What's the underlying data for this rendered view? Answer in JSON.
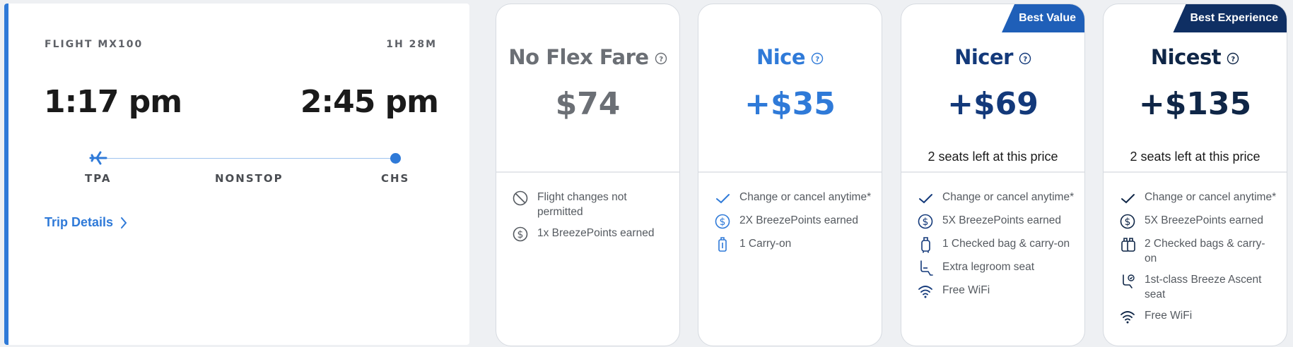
{
  "flight": {
    "number_label": "FLIGHT MX100",
    "duration": "1H 28M",
    "depart_time": "1:17 pm",
    "arrive_time": "2:45 pm",
    "origin": "TPA",
    "stops": "NONSTOP",
    "destination": "CHS",
    "trip_details_label": "Trip Details",
    "accent_color": "#2f7ad8"
  },
  "fares": [
    {
      "name": "No Flex Fare",
      "price": "$74",
      "seats_left": "",
      "badge": "",
      "color": "#6b6f75",
      "features": [
        {
          "icon": "no-changes-icon",
          "text": "Flight changes not permitted"
        },
        {
          "icon": "dollar-icon",
          "text": "1x BreezePoints earned"
        }
      ]
    },
    {
      "name": "Nice",
      "price": "+$35",
      "seats_left": "",
      "badge": "",
      "color": "#2f7ad8",
      "features": [
        {
          "icon": "check-icon",
          "text": "Change or cancel anytime*"
        },
        {
          "icon": "dollar-icon",
          "text": "2X BreezePoints earned"
        },
        {
          "icon": "carry-on-icon",
          "text": "1 Carry-on"
        }
      ]
    },
    {
      "name": "Nicer",
      "price": "+$69",
      "seats_left": "2 seats left at this price",
      "badge": "Best Value",
      "badge_color": "#1f5fb8",
      "color": "#13397a",
      "features": [
        {
          "icon": "check-icon",
          "text": "Change or cancel anytime*"
        },
        {
          "icon": "dollar-icon",
          "text": "5X BreezePoints earned"
        },
        {
          "icon": "checked-bag-icon",
          "text": "1 Checked bag & carry-on"
        },
        {
          "icon": "legroom-seat-icon",
          "text": "Extra legroom seat"
        },
        {
          "icon": "wifi-icon",
          "text": "Free WiFi"
        }
      ]
    },
    {
      "name": "Nicest",
      "price": "+$135",
      "seats_left": "2 seats left at this price",
      "badge": "Best Experience",
      "badge_color": "#0f2f63",
      "color": "#0f2647",
      "features": [
        {
          "icon": "check-icon",
          "text": "Change or cancel anytime*"
        },
        {
          "icon": "dollar-icon",
          "text": "5X BreezePoints earned"
        },
        {
          "icon": "checked-bags-icon",
          "text": "2 Checked bags & carry-on"
        },
        {
          "icon": "premium-seat-icon",
          "text": "1st-class Breeze Ascent seat"
        },
        {
          "icon": "wifi-icon",
          "text": "Free WiFi"
        }
      ]
    }
  ]
}
